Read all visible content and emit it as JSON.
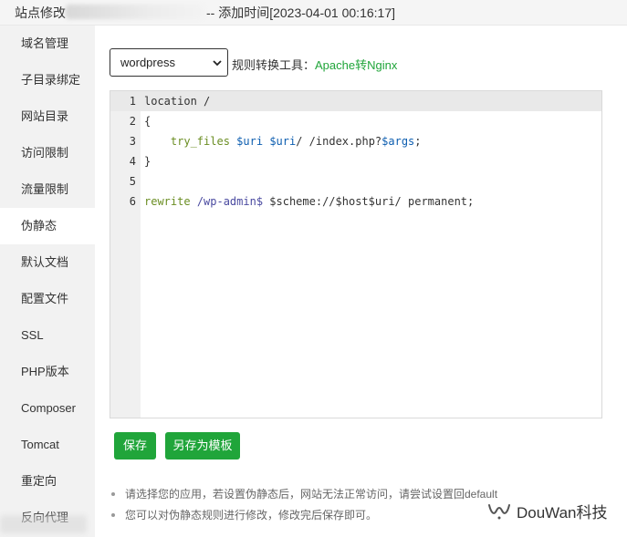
{
  "window": {
    "title_prefix": "站点修改",
    "title_suffix": " -- 添加时间[2023-04-01 00:16:17]"
  },
  "sidebar": {
    "items": [
      {
        "label": "域名管理"
      },
      {
        "label": "子目录绑定"
      },
      {
        "label": "网站目录"
      },
      {
        "label": "访问限制"
      },
      {
        "label": "流量限制"
      },
      {
        "label": "伪静态",
        "active": true
      },
      {
        "label": "默认文档"
      },
      {
        "label": "配置文件"
      },
      {
        "label": "SSL"
      },
      {
        "label": "PHP版本"
      },
      {
        "label": "Composer"
      },
      {
        "label": "Tomcat"
      },
      {
        "label": "重定向"
      },
      {
        "label": "反向代理"
      }
    ]
  },
  "rewrite": {
    "selected_template": "wordpress",
    "tool_label": "规则转换工具：",
    "tool_link": "Apache转Nginx"
  },
  "editor": {
    "lines": [
      {
        "num": "1",
        "parts": [
          {
            "t": "location /",
            "c": ""
          }
        ]
      },
      {
        "num": "2",
        "parts": [
          {
            "t": "{",
            "c": ""
          }
        ]
      },
      {
        "num": "3",
        "parts": [
          {
            "t": "    ",
            "c": ""
          },
          {
            "t": "try_files",
            "c": "kw"
          },
          {
            "t": " ",
            "c": ""
          },
          {
            "t": "$uri",
            "c": "var"
          },
          {
            "t": " ",
            "c": ""
          },
          {
            "t": "$uri",
            "c": "var"
          },
          {
            "t": "/ /index.php?",
            "c": ""
          },
          {
            "t": "$args",
            "c": "var"
          },
          {
            "t": ";",
            "c": ""
          }
        ]
      },
      {
        "num": "4",
        "parts": [
          {
            "t": "}",
            "c": ""
          }
        ]
      },
      {
        "num": "5",
        "parts": [
          {
            "t": "",
            "c": ""
          }
        ]
      },
      {
        "num": "6",
        "parts": [
          {
            "t": "rewrite",
            "c": "kw"
          },
          {
            "t": " ",
            "c": ""
          },
          {
            "t": "/wp-admin$",
            "c": "re"
          },
          {
            "t": " $scheme://$host$uri/ permanent;",
            "c": ""
          }
        ]
      }
    ]
  },
  "buttons": {
    "save": "保存",
    "save_as_template": "另存为模板"
  },
  "notes": [
    "请选择您的应用，若设置伪静态后，网站无法正常访问，请尝试设置回default",
    "您可以对伪静态规则进行修改，修改完后保存即可。"
  ],
  "watermark": {
    "text": "DouWan科技",
    "icon": "wechat-channel-icon"
  },
  "colors": {
    "accent": "#20a53a",
    "sidebar_bg": "#f2f2f2",
    "gutter_bg": "#f0f0f0"
  }
}
